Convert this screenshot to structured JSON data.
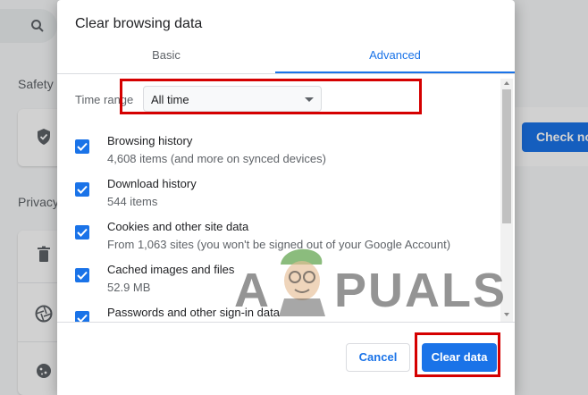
{
  "background": {
    "sections": [
      "Safety",
      "Privacy"
    ],
    "check_now_label": "Check nov"
  },
  "dialog": {
    "title": "Clear browsing data",
    "tabs": [
      {
        "label": "Basic",
        "active": false
      },
      {
        "label": "Advanced",
        "active": true
      }
    ],
    "time_range": {
      "label": "Time range",
      "value": "All time"
    },
    "items": [
      {
        "title": "Browsing history",
        "subtitle": "4,608 items (and more on synced devices)",
        "checked": true
      },
      {
        "title": "Download history",
        "subtitle": "544 items",
        "checked": true
      },
      {
        "title": "Cookies and other site data",
        "subtitle": "From 1,063 sites (you won't be signed out of your Google Account)",
        "checked": true
      },
      {
        "title": "Cached images and files",
        "subtitle": "52.9 MB",
        "checked": true
      },
      {
        "title": "Passwords and other sign-in data",
        "subtitle": "",
        "checked": true
      }
    ],
    "buttons": {
      "cancel": "Cancel",
      "clear": "Clear data"
    }
  },
  "watermark": {
    "left": "A",
    "right": "PUALS"
  },
  "colors": {
    "accent": "#1a73e8",
    "highlight": "#d50000"
  },
  "icons": [
    "search-icon",
    "shield-icon",
    "trash-icon",
    "aperture-icon",
    "cookie-icon",
    "caret-down-icon",
    "checkmark-icon"
  ]
}
